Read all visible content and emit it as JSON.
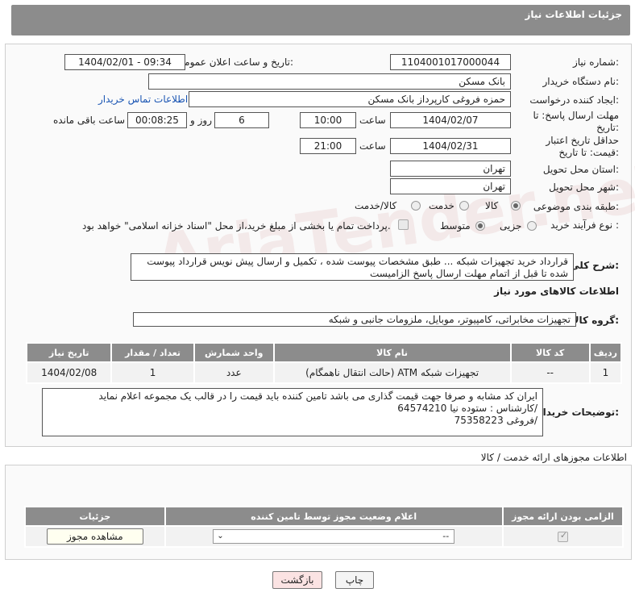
{
  "header": {
    "title": "جزئیات اطلاعات نیاز"
  },
  "form": {
    "need_number_label": "شماره نیاز:",
    "need_number": "1104001017000044",
    "announce_label": "تاریخ و ساعت اعلان عمومی:",
    "announce_value": "1404/02/01 - 09:34",
    "buyer_org_label": "نام دستگاه خریدار:",
    "buyer_org": "بانک مسکن",
    "creator_label": "ایجاد کننده درخواست:",
    "creator": "حمزه فروغی کارپرداز بانک مسکن",
    "contact_link": "اطلاعات تماس خریدار",
    "deadline_label": "مهلت ارسال پاسخ: تا تاریخ:",
    "deadline_date": "1404/02/07",
    "time_label": "ساعت",
    "deadline_time": "10:00",
    "days_value": "6",
    "days_and_label": "روز و",
    "remaining_time": "00:08:25",
    "remaining_label": "ساعت باقی مانده",
    "validity_label": "حداقل تاریخ اعتبار قیمت: تا تاریخ:",
    "validity_date": "1404/02/31",
    "validity_time": "21:00",
    "province_label": "استان محل تحویل:",
    "province": "تهران",
    "city_label": "شهر محل تحویل:",
    "city": "تهران",
    "category_label": "طبقه بندی موضوعی:",
    "category_options": [
      "کالا",
      "خدمت",
      "کالا/خدمت"
    ],
    "process_label": "نوع فرآیند خرید :",
    "process_options": [
      "جزیی",
      "متوسط"
    ],
    "payment_note": "پرداخت تمام یا بخشی از مبلغ خرید،از محل \"اسناد خزانه اسلامی\" خواهد بود."
  },
  "description": {
    "label": "شرح کلی نیاز:",
    "text": "قرارداد خرید تجهیزات شبکه ...   طبق مشخصات پیوست شده ، تکمیل و ارسال پیش نویس قرارداد پیوست شده تا قبل از اتمام مهلت ارسال پاسخ الزامیست"
  },
  "goods": {
    "section_title": "اطلاعات کالاهای مورد نیاز",
    "group_label": "گروه کالا:",
    "group_value": "تجهیزات مخابراتی، کامپیوتر، موبایل، ملزومات جانبی و شبکه",
    "columns": [
      "ردیف",
      "کد کالا",
      "نام کالا",
      "واحد شمارش",
      "تعداد / مقدار",
      "تاریخ نیاز"
    ],
    "rows": [
      {
        "index": "1",
        "code": "--",
        "name": "تجهیزات شبکه ATM (حالت انتقال ناهمگام)",
        "unit": "عدد",
        "qty": "1",
        "date": "1404/02/08"
      }
    ]
  },
  "buyer_notes": {
    "label": "توضیحات خریدار:",
    "line1": "ایران کد مشابه و صرفا جهت قیمت گذاری می باشد تامین کننده باید قیمت را در قالب یک مجموعه اعلام نماید",
    "line2": "/کارشناس : ستوده نیا  64574210",
    "line3": "/فروغی 75358223"
  },
  "permits": {
    "section_title": "اطلاعات مجوزهای ارائه خدمت / کالا",
    "columns": [
      "الزامی بودن ارائه مجوز",
      "اعلام وضعیت مجوز توسط تامین کننده",
      "جزئیات"
    ],
    "select_value": "--",
    "view_button": "مشاهده مجوز"
  },
  "buttons": {
    "print": "چاپ",
    "back": "بازگشت"
  },
  "watermark": "AriaTender.neT"
}
